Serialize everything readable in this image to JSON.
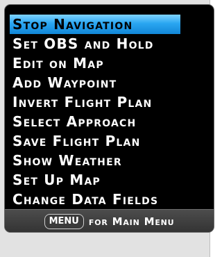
{
  "menu": {
    "selected_index": 0,
    "items": [
      {
        "label": "Stop Navigation"
      },
      {
        "label": "Set OBS and Hold"
      },
      {
        "label": "Edit on Map"
      },
      {
        "label": "Add Waypoint"
      },
      {
        "label": "Invert Flight Plan"
      },
      {
        "label": "Select Approach"
      },
      {
        "label": "Save Flight Plan"
      },
      {
        "label": "Show Weather"
      },
      {
        "label": "Set Up Map"
      },
      {
        "label": "Change Data Fields"
      }
    ]
  },
  "footer": {
    "key_label": "MENU",
    "text": "for Main Menu"
  },
  "colors": {
    "background": "#000000",
    "text": "#ffffff",
    "selection": "#1e9be6",
    "footer_bg": "#3f3f3f"
  }
}
